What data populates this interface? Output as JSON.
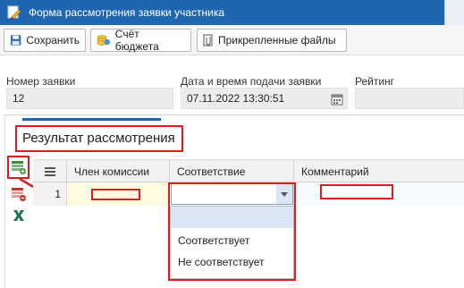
{
  "window": {
    "title": "Форма рассмотрения заявки участника"
  },
  "toolbar": {
    "save_label": "Сохранить",
    "budget_label": "Счёт бюджета",
    "files_label": "Прикрепленные файлы"
  },
  "fields": {
    "number": {
      "label": "Номер заявки",
      "value": "12"
    },
    "datetime": {
      "label": "Дата и время подачи заявки",
      "value": "07.11.2022 13:30:51"
    },
    "rating": {
      "label": "Рейтинг",
      "value": ""
    }
  },
  "section": {
    "title": "Результат рассмотрения"
  },
  "grid": {
    "columns": [
      "Член комиссии",
      "Соответствие",
      "Комментарий"
    ],
    "rows": [
      {
        "num": "1",
        "member": "",
        "compliance": "",
        "comment": ""
      }
    ]
  },
  "dropdown": {
    "options": [
      "",
      "Соответствует",
      "Не соответствует"
    ]
  },
  "colors": {
    "titlebar": "#1f66b0",
    "highlight": "#e01b1b",
    "selected_row": "#fffbe0",
    "dropdown_highlight": "#dbe6f5",
    "excel_green": "#217346"
  },
  "icons": [
    "pencil-icon",
    "budget-coins-icon",
    "attachment-icon",
    "calendar-icon",
    "add-row-icon",
    "delete-row-icon",
    "excel-export-icon",
    "menu-icon",
    "arrow-indicator-icon",
    "dropdown-arrow-icon"
  ]
}
